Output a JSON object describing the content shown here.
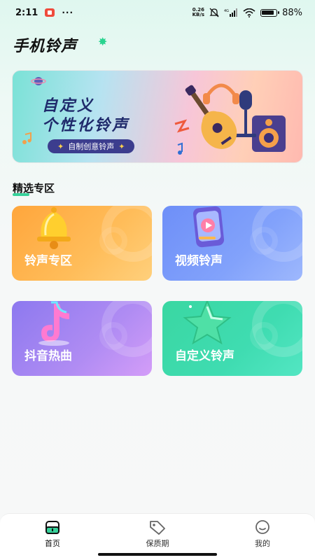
{
  "status_bar": {
    "time": "2:11",
    "more": "···",
    "net_speed_value": "0.26",
    "net_speed_unit": "KB/s",
    "network": "4G",
    "battery": "88%"
  },
  "app": {
    "title": "手机铃声"
  },
  "banner": {
    "title_line1": "自定义",
    "title_line2": "个性化铃声",
    "pill": "自制创意铃声"
  },
  "section": {
    "title": "精选专区"
  },
  "cards": [
    {
      "label": "铃声专区",
      "icon": "bell-icon"
    },
    {
      "label": "视频铃声",
      "icon": "video-phone-icon"
    },
    {
      "label": "抖音热曲",
      "icon": "douyin-note-icon"
    },
    {
      "label": "自定义铃声",
      "icon": "star-icon"
    }
  ],
  "tabbar": {
    "tabs": [
      {
        "label": "首页",
        "icon": "home-icon",
        "active": true
      },
      {
        "label": "保质期",
        "icon": "tag-icon",
        "active": false
      },
      {
        "label": "我的",
        "icon": "smile-icon",
        "active": false
      }
    ]
  },
  "colors": {
    "accent": "#36d19a",
    "card_orange": "#ffa63c",
    "card_blue": "#6e8ff8",
    "card_purple": "#8d79ef",
    "card_green": "#3ad7a2"
  }
}
